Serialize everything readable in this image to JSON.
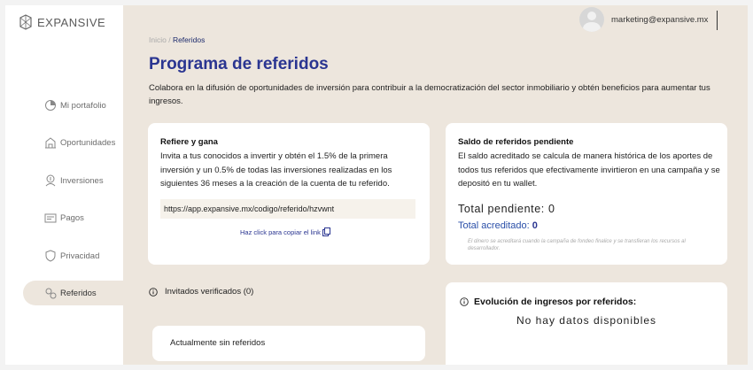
{
  "app": {
    "logo_text": "EXPANSIVE"
  },
  "sidebar": {
    "items": [
      {
        "label": "Mi portafolio",
        "icon": "portfolio-icon"
      },
      {
        "label": "Oportunidades",
        "icon": "building-icon"
      },
      {
        "label": "Inversiones",
        "icon": "investment-icon"
      },
      {
        "label": "Pagos",
        "icon": "payments-icon"
      },
      {
        "label": "Privacidad",
        "icon": "shield-icon"
      },
      {
        "label": "Referidos",
        "icon": "referrals-icon",
        "active": true
      }
    ]
  },
  "header": {
    "user_email": "marketing@expansive.mx"
  },
  "breadcrumb": {
    "root": "Inicio",
    "separator": " / ",
    "current": "Referidos"
  },
  "page": {
    "title": "Programa de referidos",
    "description": "Colabora en la difusión de oportunidades de inversión para contribuir a la democratización del sector inmobiliario y obtén beneficios para aumentar tus ingresos."
  },
  "refer_card": {
    "title": "Refiere y gana",
    "text": "Invita a tus conocidos a invertir y obtén el 1.5% de la primera inversión y un 0.5% de todas las inversiones realizadas en los siguientes 36 meses a la creación de la cuenta de tu referido.",
    "link": "https://app.expansive.mx/codigo/referido/hzvwnt",
    "copy_label": "Haz click para copiar el link"
  },
  "saldo_card": {
    "title": "Saldo de referidos pendiente",
    "text": "El saldo acreditado se calcula de manera histórica de los aportes de todos tus referidos que efectivamente invirtieron en una campaña y se depositó en tu wallet.",
    "pending_label": "Total pendiente: ",
    "pending_value": "0",
    "credited_label": "Total acreditado: ",
    "credited_value": "0",
    "note": "El dinero se acreditará cuando la campaña de fondeo finalice y se transfieran los recursos al desarrollador."
  },
  "verified": {
    "label": "Invitados verificados (0)"
  },
  "empty_card": {
    "text": "Actualmente sin referidos"
  },
  "evolution_card": {
    "title": "Evolución de ingresos por referidos:",
    "no_data": "No hay datos disponibles"
  },
  "colors": {
    "accent": "#2a3591",
    "background": "#ede6dd",
    "card": "#ffffff"
  }
}
